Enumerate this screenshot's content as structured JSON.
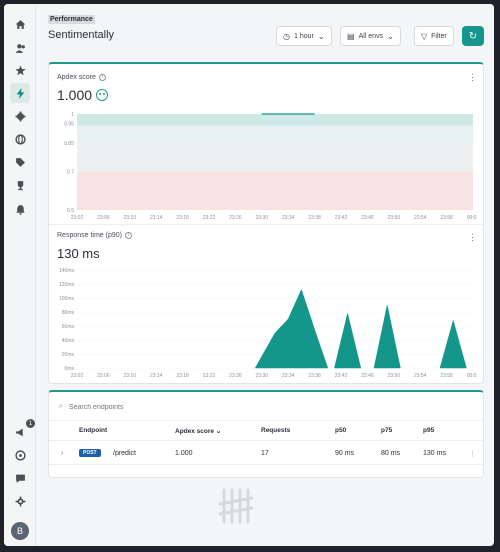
{
  "sidebar": {
    "top_icons": [
      "home-icon",
      "users-icon",
      "star-icon",
      "bolt-icon",
      "settings-cog-icon",
      "globe-icon",
      "tag-icon",
      "trophy-icon",
      "bell-icon"
    ],
    "bottom_icons": [
      "megaphone-icon",
      "help-icon",
      "chat-icon",
      "gear-icon"
    ],
    "notification_count": "1",
    "avatar_initial": "B"
  },
  "header": {
    "breadcrumb": "Performance",
    "title": "Sentimentally",
    "time_range": "1 hour",
    "environment": "All envs",
    "filter": "Filter"
  },
  "apdex": {
    "title": "Apdex score",
    "value": "1.000"
  },
  "response_time": {
    "title": "Response time (p90)",
    "value": "130 ms"
  },
  "chart_data": [
    {
      "type": "area",
      "title": "Apdex score",
      "x": [
        "23:02",
        "23:06",
        "23:10",
        "23:14",
        "23:18",
        "23:22",
        "23:26",
        "23:30",
        "23:34",
        "23:38",
        "23:42",
        "23:46",
        "23:50",
        "23:54",
        "23:58",
        "00:02"
      ],
      "yticks": [
        "1",
        "0.95",
        "0.85",
        "0.7",
        "0.5"
      ],
      "ylim": [
        0.5,
        1
      ],
      "bands": [
        {
          "from": 0.94,
          "to": 1.0,
          "color": "#cfe9e6"
        },
        {
          "from": 0.85,
          "to": 0.94,
          "color": "#e6f2f1"
        },
        {
          "from": 0.7,
          "to": 0.85,
          "color": "#eeeff1"
        },
        {
          "from": 0.5,
          "to": 0.7,
          "color": "#f6e3e2"
        }
      ],
      "series": [
        {
          "points": [
            {
              "x": "23:30",
              "y": 1.0
            },
            {
              "x": "23:38",
              "y": 1.0
            }
          ]
        }
      ]
    },
    {
      "type": "area",
      "title": "Response time (p90)",
      "x": [
        "23:02",
        "23:06",
        "23:10",
        "23:14",
        "23:18",
        "23:22",
        "23:26",
        "23:30",
        "23:34",
        "23:38",
        "23:42",
        "23:46",
        "23:50",
        "23:54",
        "23:58",
        "00:02"
      ],
      "yticks": [
        "140ms",
        "120ms",
        "100ms",
        "80ms",
        "60ms",
        "40ms",
        "20ms",
        "0ms"
      ],
      "ylim": [
        0,
        140
      ],
      "series": [
        {
          "points": [
            {
              "x": "23:29",
              "y": 0
            },
            {
              "x": "23:32",
              "y": 50
            },
            {
              "x": "23:34",
              "y": 70
            },
            {
              "x": "23:36",
              "y": 112
            },
            {
              "x": "23:38",
              "y": 55
            },
            {
              "x": "23:40",
              "y": 0
            }
          ]
        },
        {
          "points": [
            {
              "x": "23:41",
              "y": 0
            },
            {
              "x": "23:43",
              "y": 78
            },
            {
              "x": "23:45",
              "y": 0
            }
          ]
        },
        {
          "points": [
            {
              "x": "23:47",
              "y": 0
            },
            {
              "x": "23:49",
              "y": 90
            },
            {
              "x": "23:51",
              "y": 0
            }
          ]
        },
        {
          "points": [
            {
              "x": "23:57",
              "y": 0
            },
            {
              "x": "23:59",
              "y": 68
            },
            {
              "x": "00:01",
              "y": 0
            }
          ]
        }
      ],
      "color": "#14968a"
    }
  ],
  "endpoints": {
    "search_placeholder": "Search endpoints",
    "columns": [
      "Endpoint",
      "Apdex score",
      "Requests",
      "p50",
      "p75",
      "p95"
    ],
    "rows": [
      {
        "method": "POST",
        "path": "/predict",
        "apdex": "1.000",
        "requests": "17",
        "p50": "90 ms",
        "p75": "80 ms",
        "p95": "130 ms"
      }
    ]
  }
}
